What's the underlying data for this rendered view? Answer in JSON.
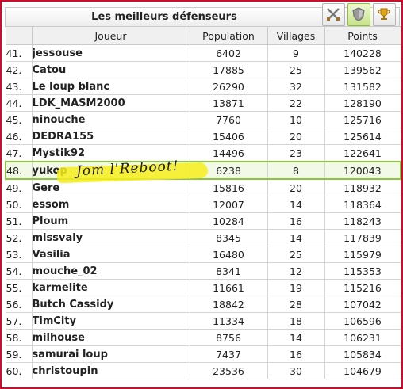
{
  "title": "Les meilleurs défenseurs",
  "icons": [
    "swords-icon",
    "shield-icon",
    "trophy-icon"
  ],
  "columns": [
    "Joueur",
    "Population",
    "Villages",
    "Points"
  ],
  "rows": [
    {
      "rank": "41.",
      "player": "jessouse",
      "population": "6402",
      "villages": "9",
      "points": "140228"
    },
    {
      "rank": "42.",
      "player": "Catou",
      "population": "17885",
      "villages": "25",
      "points": "139562"
    },
    {
      "rank": "43.",
      "player": "Le loup blanc",
      "population": "26290",
      "villages": "32",
      "points": "131582"
    },
    {
      "rank": "44.",
      "player": "LDK_MASM2000",
      "population": "13871",
      "villages": "22",
      "points": "128190"
    },
    {
      "rank": "45.",
      "player": "ninouche",
      "population": "7760",
      "villages": "10",
      "points": "125716"
    },
    {
      "rank": "46.",
      "player": "DEDRA155",
      "population": "15406",
      "villages": "20",
      "points": "125614"
    },
    {
      "rank": "47.",
      "player": "Mystik92",
      "population": "14496",
      "villages": "23",
      "points": "122641"
    },
    {
      "rank": "48.",
      "player": "yukop",
      "population": "6238",
      "villages": "8",
      "points": "120043"
    },
    {
      "rank": "49.",
      "player": "Gere",
      "population": "15816",
      "villages": "20",
      "points": "118932"
    },
    {
      "rank": "50.",
      "player": "essom",
      "population": "12007",
      "villages": "14",
      "points": "118364"
    },
    {
      "rank": "51.",
      "player": "Ploum",
      "population": "10284",
      "villages": "16",
      "points": "118243"
    },
    {
      "rank": "52.",
      "player": "missvaly",
      "population": "8345",
      "villages": "14",
      "points": "117839"
    },
    {
      "rank": "53.",
      "player": "Vasilia",
      "population": "16480",
      "villages": "25",
      "points": "115979"
    },
    {
      "rank": "54.",
      "player": "mouche_02",
      "population": "8341",
      "villages": "12",
      "points": "115353"
    },
    {
      "rank": "55.",
      "player": "karmelite",
      "population": "11661",
      "villages": "19",
      "points": "115216"
    },
    {
      "rank": "56.",
      "player": "Butch Cassidy",
      "population": "18842",
      "villages": "28",
      "points": "107042"
    },
    {
      "rank": "57.",
      "player": "TimCity",
      "population": "11334",
      "villages": "18",
      "points": "106596"
    },
    {
      "rank": "58.",
      "player": "milhouse",
      "population": "8756",
      "villages": "14",
      "points": "106231"
    },
    {
      "rank": "59.",
      "player": "samurai loup",
      "population": "7437",
      "villages": "16",
      "points": "105834"
    },
    {
      "rank": "60.",
      "player": "christoupin",
      "population": "23536",
      "villages": "30",
      "points": "104679"
    }
  ],
  "annotation": "Jom l'Reboot!",
  "colors": {
    "player_link": "#6fb51e",
    "highlight_border": "#8cc63f",
    "marker": "#f6ee1c",
    "frame": "#c8102e"
  }
}
